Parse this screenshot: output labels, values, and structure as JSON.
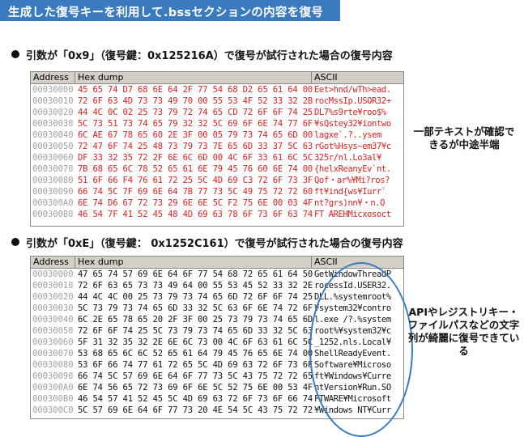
{
  "title": "生成した復号キーを利用して.bssセクションの内容を復号",
  "section1": {
    "heading": "引数が「0x9」（復号鍵：0x125216A）で復号が試行された場合の復号内容",
    "header": {
      "address": "Address",
      "hex": "Hex dump",
      "ascii": "ASCII"
    },
    "rows": [
      {
        "addr": "00030000",
        "hex": "45 65 74 D7 68 6E 64 2F 77 54 68 D2 65 61 64 00",
        "ascii": "Eet>hnd/wTh>ead."
      },
      {
        "addr": "00030010",
        "hex": "72 6F 63 4D 73 73 49 70 00 55 53 4F 52 33 32 2B",
        "ascii": "rocMssIp.USOR32+"
      },
      {
        "addr": "00030020",
        "hex": "44 4C 0C 02 25 73 79 72 74 65 CD 72 6F 6F 74 25",
        "ascii": "DL7%s9rte¥roo$%"
      },
      {
        "addr": "00030030",
        "hex": "5C 73 51 73 74 65 79 32 32 5C 69 6F 6E 74 77 6F",
        "ascii": "¥sQstey32¥iontwo"
      },
      {
        "addr": "00030040",
        "hex": "6C AE 67 78 65 60 2E 3F 00 05 79 73 74 65 6D 00",
        "ascii": "lagxe`.?..ysem"
      },
      {
        "addr": "00030050",
        "hex": "72 47 6F 74 25 48 73 79 73 7E 65 6D 33 37 5C 63",
        "ascii": "rGot%Hsys~em37¥c"
      },
      {
        "addr": "00030060",
        "hex": "DF 33 32 35 72 2F 6E 6C 6D 00 4C 6F 33 61 6C 5C",
        "ascii": "325r/nl.Lo3al¥"
      },
      {
        "addr": "00030070",
        "hex": "7B 68 65 6C 78 52 65 61 6E 79 45 76 60 6E 74 00",
        "ascii": "{helxReanyEv`nt."
      },
      {
        "addr": "00030080",
        "hex": "51 6F 66 F4 76 61 72 25 5C 4D 69 C3 72 6F 73 3F",
        "ascii": "Qof・ar%¥Mi?ros?"
      },
      {
        "addr": "00030090",
        "hex": "66 74 5C 7F 69 6E 64 7B 77 73 5C 49 75 72 72 60",
        "ascii": "ft¥ind{ws¥Iurr`"
      },
      {
        "addr": "000300A0",
        "hex": "6E 74 D6 67 72 73 29 6E 6E 5C F2 75 6E 00 03 4F",
        "ascii": "nt?grs)nn¥・n.O"
      },
      {
        "addr": "000300B0",
        "hex": "46 54 7F 41 52 45 48 4D 69 63 78 6F 73 6F 63 74",
        "ascii": "FT AREHMicxosoct"
      }
    ]
  },
  "note1": "一部テキストが確認できるが中途半端",
  "section2": {
    "heading": "引数が「0xE」（復号鍵： 0x1252C161）で復号が試行された場合の復号内容",
    "header": {
      "address": "Address",
      "hex": "Hex dump",
      "ascii": "ASCII"
    },
    "rows": [
      {
        "addr": "00030000",
        "hex": "47 65 74 57 69 6E 64 6F 77 54 68 72 65 61 64 50",
        "ascii": "GetWindowThreadP"
      },
      {
        "addr": "00030010",
        "hex": "72 6F 63 65 73 73 49 64 00 55 53 45 52 33 32 2E",
        "ascii": "rocessId.USER32."
      },
      {
        "addr": "00030020",
        "hex": "44 4C 4C 00 25 73 79 73 74 65 6D 72 6F 6F 74 25",
        "ascii": "DLL.%systemroot%"
      },
      {
        "addr": "00030030",
        "hex": "5C 73 79 73 74 65 6D 33 32 5C 63 6F 6E 74 72 6F",
        "ascii": "¥system32¥contro"
      },
      {
        "addr": "00030040",
        "hex": "6C 2E 65 78 65 20 2F 3F 00 25 73 79 73 74 65 6D",
        "ascii": "l.exe /?.%system"
      },
      {
        "addr": "00030050",
        "hex": "72 6F 6F 74 25 5C 73 79 73 74 65 6D 33 32 5C 63",
        "ascii": "root%¥system32¥c"
      },
      {
        "addr": "00030060",
        "hex": "5F 31 32 35 32 2E 6E 6C 73 00 4C 6F 63 61 6C 5C",
        "ascii": "_1252.nls.Local¥"
      },
      {
        "addr": "00030070",
        "hex": "53 68 65 6C 6C 52 65 61 64 79 45 76 65 6E 74 00",
        "ascii": "ShellReadyEvent."
      },
      {
        "addr": "00030080",
        "hex": "53 6F 66 74 77 61 72 65 5C 4D 69 63 72 6F 73 6F",
        "ascii": "Software¥Microso"
      },
      {
        "addr": "00030090",
        "hex": "66 74 5C 57 69 6E 64 6F 77 73 5C 43 75 72 72 65",
        "ascii": "ft¥Windows¥Curre"
      },
      {
        "addr": "000300A0",
        "hex": "6E 74 56 65 72 73 69 6F 6E 5C 52 75 6E 00 53 4F",
        "ascii": "ntVersion¥Run.SO"
      },
      {
        "addr": "000300B0",
        "hex": "46 54 57 41 52 45 5C 4D 69 63 72 6F 73 6F 66 74",
        "ascii": "FTWARE¥Microsoft"
      },
      {
        "addr": "000300C0",
        "hex": "5C 57 69 6E 64 6F 77 73 20 4E 54 5C 43 75 72 72",
        "ascii": "¥Windows NT¥Curr"
      }
    ]
  },
  "note2": "APIやレジストリキー・ファイルパスなどの文字列が綺麗に復号できている"
}
